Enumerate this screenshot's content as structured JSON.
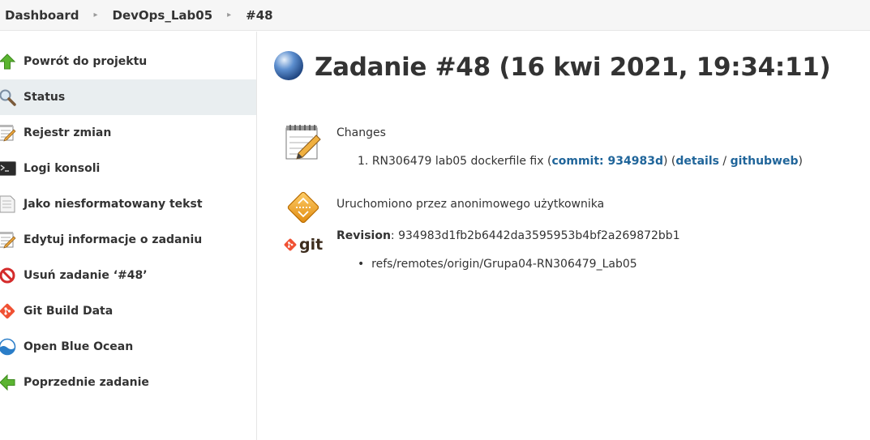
{
  "breadcrumb": {
    "items": [
      "Dashboard",
      "DevOps_Lab05",
      "#48"
    ],
    "separator": "▸"
  },
  "sidebar": {
    "items": [
      {
        "label": "Powrót do projektu",
        "icon": "up-arrow-icon"
      },
      {
        "label": "Status",
        "icon": "search-icon"
      },
      {
        "label": "Rejestr zmian",
        "icon": "notepad-icon"
      },
      {
        "label": "Logi konsoli",
        "icon": "terminal-icon"
      },
      {
        "label": "Jako niesformatowany tekst",
        "icon": "document-icon"
      },
      {
        "label": "Edytuj informacje o zadaniu",
        "icon": "notepad-edit-icon"
      },
      {
        "label": "Usuń zadanie ‘#48’",
        "icon": "no-entry-icon"
      },
      {
        "label": "Git Build Data",
        "icon": "git-icon"
      },
      {
        "label": "Open Blue Ocean",
        "icon": "blue-ocean-icon"
      },
      {
        "label": "Poprzednie zadanie",
        "icon": "left-arrow-icon"
      }
    ],
    "active_index": 1
  },
  "main": {
    "title": "Zadanie #48 (16 kwi 2021, 19:34:11)",
    "status_icon": "blue-ball-icon",
    "changes": {
      "heading": "Changes",
      "items": [
        {
          "number": "1.",
          "text": "RN306479 lab05 dockerfile fix",
          "commit_label": "commit: 934983d",
          "details_label": "details",
          "githubweb_label": "githubweb"
        }
      ]
    },
    "cause": "Uruchomiono przez anonimowego użytkownika",
    "git": {
      "revision_label": "Revision",
      "revision": "934983d1fb2b6442da3595953b4bf2a269872bb1",
      "branches": [
        "refs/remotes/origin/Grupa04-RN306479_Lab05"
      ],
      "logo_text": "git"
    }
  },
  "colors": {
    "link": "#20659a",
    "active_bg": "#e9eef0",
    "git_orange": "#f05133"
  }
}
